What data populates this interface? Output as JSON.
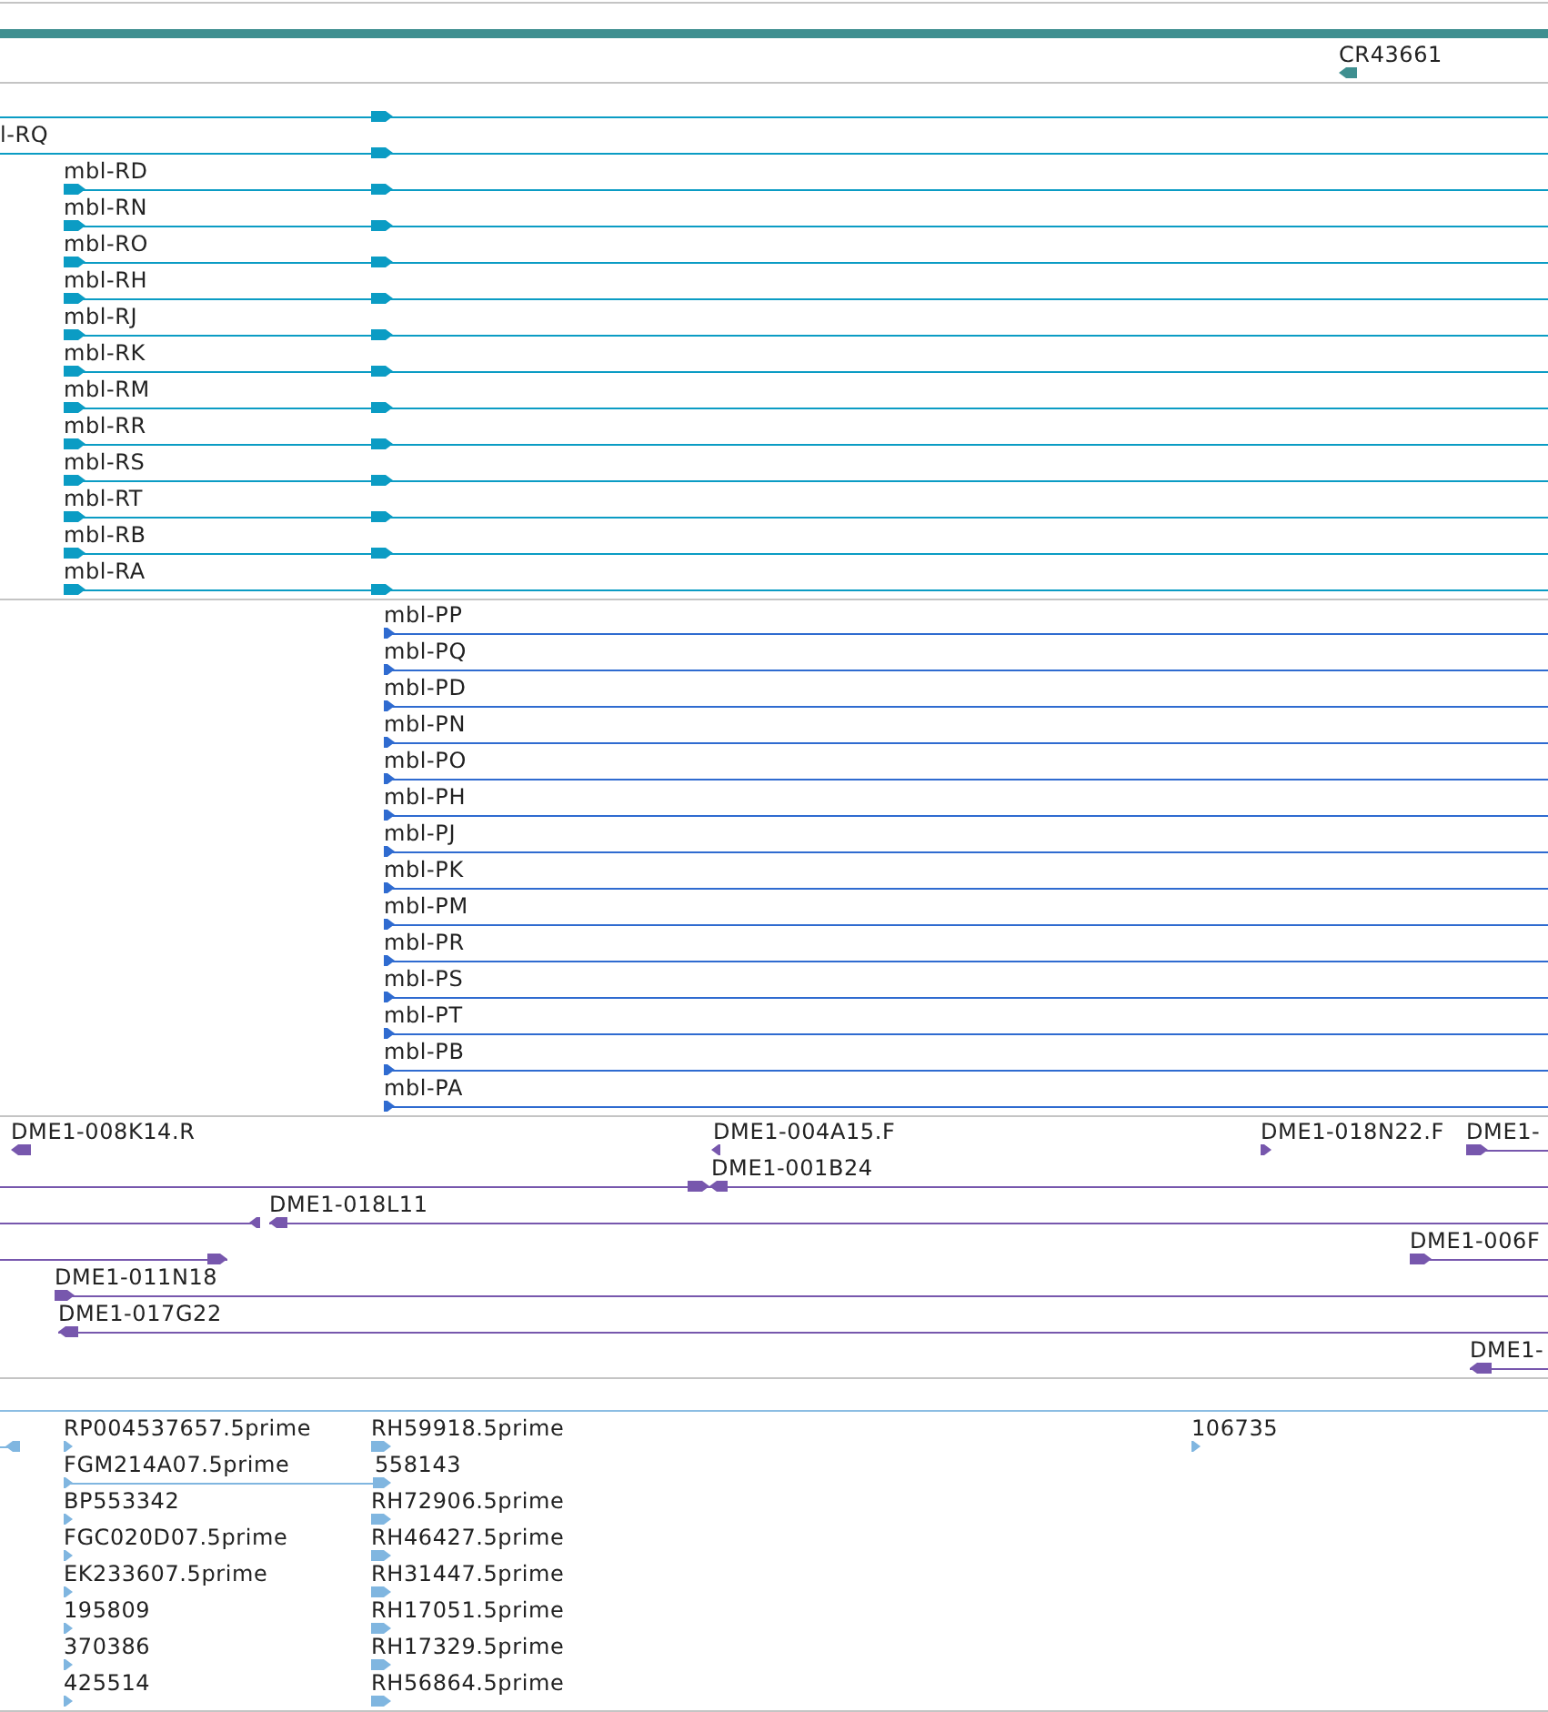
{
  "gene_track": {
    "features": [
      {
        "label": "CR43661",
        "reverse": true
      }
    ]
  },
  "transcript_track": {
    "rows": [
      {
        "reverse": false
      },
      {
        "label": "l-RQ",
        "reverse": false
      },
      {
        "label": "mbl-RD",
        "reverse": false
      },
      {
        "label": "mbl-RN",
        "reverse": false
      },
      {
        "label": "mbl-RO",
        "reverse": false
      },
      {
        "label": "mbl-RH",
        "reverse": false
      },
      {
        "label": "mbl-RJ",
        "reverse": false
      },
      {
        "label": "mbl-RK",
        "reverse": false
      },
      {
        "label": "mbl-RM",
        "reverse": false
      },
      {
        "label": "mbl-RR",
        "reverse": false
      },
      {
        "label": "mbl-RS",
        "reverse": false
      },
      {
        "label": "mbl-RT",
        "reverse": false
      },
      {
        "label": "mbl-RB",
        "reverse": false
      },
      {
        "label": "mbl-RA",
        "reverse": false
      }
    ]
  },
  "protein_track": {
    "rows": [
      {
        "label": "mbl-PP",
        "reverse": false
      },
      {
        "label": "mbl-PQ",
        "reverse": false
      },
      {
        "label": "mbl-PD",
        "reverse": false
      },
      {
        "label": "mbl-PN",
        "reverse": false
      },
      {
        "label": "mbl-PO",
        "reverse": false
      },
      {
        "label": "mbl-PH",
        "reverse": false
      },
      {
        "label": "mbl-PJ",
        "reverse": false
      },
      {
        "label": "mbl-PK",
        "reverse": false
      },
      {
        "label": "mbl-PM",
        "reverse": false
      },
      {
        "label": "mbl-PR",
        "reverse": false
      },
      {
        "label": "mbl-PS",
        "reverse": false
      },
      {
        "label": "mbl-PT",
        "reverse": false
      },
      {
        "label": "mbl-PB",
        "reverse": false
      },
      {
        "label": "mbl-PA",
        "reverse": false
      }
    ]
  },
  "clone_track": {
    "features": [
      {
        "label": "DME1-008K14.R",
        "reverse": true
      },
      {
        "label": "DME1-004A15.F",
        "reverse": true
      },
      {
        "label": "DME1-018N22.F",
        "reverse": false
      },
      {
        "label": "DME1-",
        "reverse": false
      },
      {
        "reverse": false
      },
      {
        "label": "DME1-001B24",
        "reverse": true
      },
      {
        "reverse": true
      },
      {
        "label": "DME1-018L11",
        "reverse": true
      },
      {
        "reverse": false
      },
      {
        "label": "DME1-006F",
        "reverse": false
      },
      {
        "label": "DME1-011N18",
        "reverse": false
      },
      {
        "label": "DME1-017G22",
        "reverse": true
      },
      {
        "label": "DME1-",
        "reverse": true
      }
    ]
  },
  "est_track": {
    "features": [
      {
        "reverse": true
      },
      {
        "label": "RP004537657.5prime",
        "reverse": false
      },
      {
        "label": "RH59918.5prime",
        "reverse": false
      },
      {
        "label": "106735",
        "reverse": false
      },
      {
        "label": "FGM214A07.5prime",
        "reverse": false
      },
      {
        "label": "558143",
        "reverse": false
      },
      {
        "label": "BP553342",
        "reverse": false
      },
      {
        "label": "RH72906.5prime",
        "reverse": false
      },
      {
        "label": "FGC020D07.5prime",
        "reverse": false
      },
      {
        "label": "RH46427.5prime",
        "reverse": false
      },
      {
        "label": "EK233607.5prime",
        "reverse": false
      },
      {
        "label": "RH31447.5prime",
        "reverse": false
      },
      {
        "label": "195809",
        "reverse": false
      },
      {
        "label": "RH17051.5prime",
        "reverse": false
      },
      {
        "label": "370386",
        "reverse": false
      },
      {
        "label": "RH17329.5prime",
        "reverse": false
      },
      {
        "label": "425514",
        "reverse": false
      },
      {
        "label": "RH56864.5prime",
        "reverse": false
      }
    ]
  }
}
